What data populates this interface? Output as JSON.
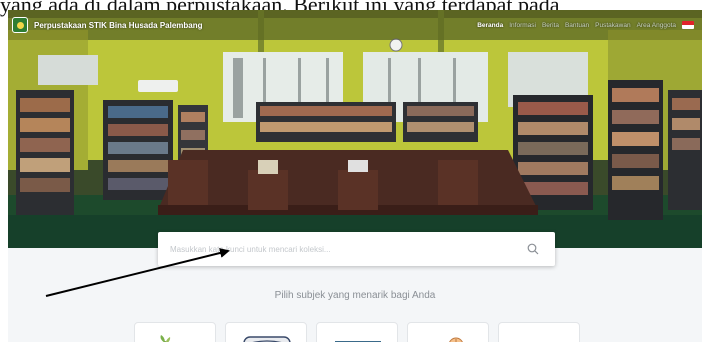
{
  "document": {
    "line_text": "yang ada di dalam perpustakaan. Berikut ini yang terdapat pada"
  },
  "navbar": {
    "brand_name": "Perpustakaan STIK Bina Husada Palembang",
    "menu": [
      "Beranda",
      "Informasi",
      "Berita",
      "Bantuan",
      "Pustakawan",
      "Area Anggota"
    ],
    "active_menu": "Beranda",
    "flag_colors": [
      "#e0232a",
      "#ffffff"
    ]
  },
  "hero": {
    "search_placeholder": "Masukkan kata kunci untuk mencari koleksi..."
  },
  "main": {
    "subtitle": "Pilih subjek yang menarik bagi Anda",
    "subject_cards": [
      {
        "icon": "plant-icon"
      },
      {
        "icon": "book-icon"
      },
      {
        "icon": "laptop-icon"
      },
      {
        "icon": "lightbulb-icon"
      },
      {
        "icon": "blank-icon"
      }
    ]
  },
  "colors": {
    "wall": "#c9d23e",
    "floor": "#1d4a2c",
    "page_bg": "#f4f6f8",
    "shelf": "#2c2e32"
  }
}
